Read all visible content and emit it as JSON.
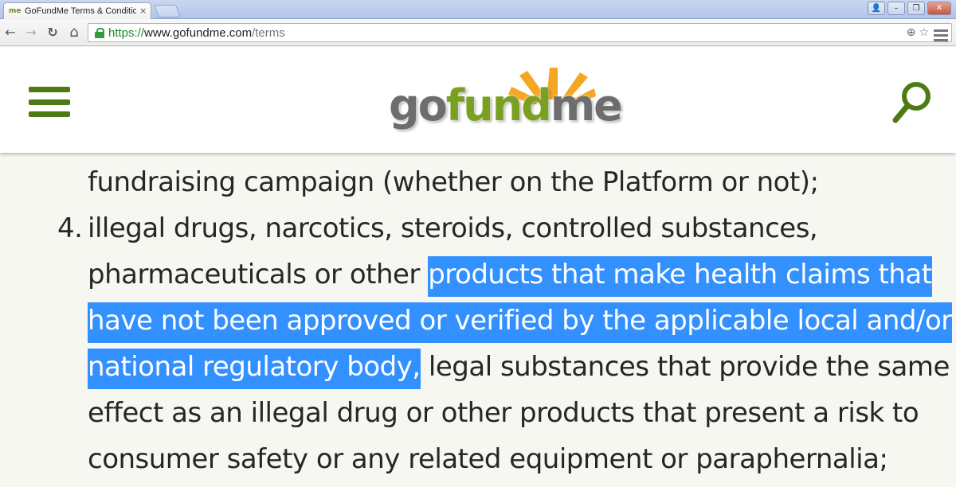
{
  "browser": {
    "tab": {
      "favicon_text": "me",
      "title": "GoFundMe Terms & Condition",
      "close_glyph": "×"
    },
    "window_controls": {
      "user": "👤",
      "minimize": "–",
      "restore": "❐",
      "close": "✕"
    },
    "toolbar": {
      "back": "←",
      "forward": "→",
      "reload": "↻",
      "home": "⌂"
    },
    "address": {
      "scheme": "https://",
      "host": "www.gofundme.com",
      "path": "/terms"
    },
    "omnibox_icons": {
      "zoom": "⊕",
      "bookmark": "☆"
    }
  },
  "header": {
    "logo": {
      "go": "go",
      "fund": "fund",
      "me": "me"
    },
    "colors": {
      "brand_green": "#4e7a12",
      "logo_orange": "#f5a623"
    }
  },
  "article": {
    "line1": "fundraising campaign (whether on the Platform or not);",
    "list_number": "4.",
    "line2": "illegal drugs, narcotics, steroids, controlled substances,",
    "line3_plain": "pharmaceuticals or other ",
    "line3_highlight": "products that make health claims that",
    "line4_highlight": "have not been approved or verified by the applicable local and/or",
    "line5_highlight": "national regulatory body,",
    "line5_plain": " legal substances that provide the same",
    "line6": "effect as an illegal drug or other products that present a risk to",
    "line7": "consumer safety or any related equipment or paraphernalia;",
    "highlight_color": "#3390ff"
  }
}
